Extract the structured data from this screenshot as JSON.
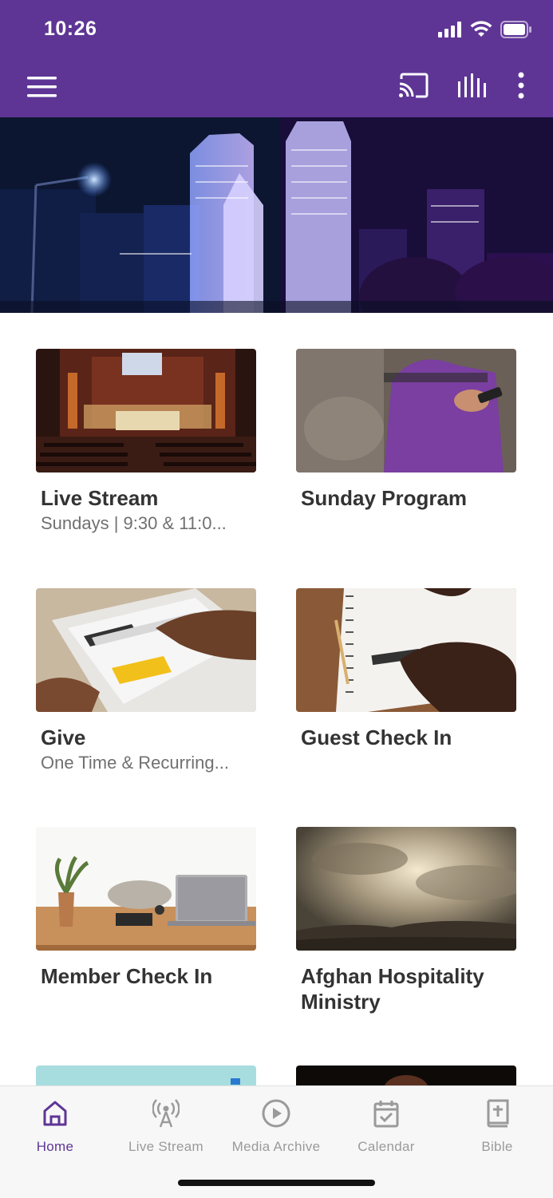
{
  "status_bar": {
    "time": "10:26"
  },
  "app_bar": {
    "menu_icon": "hamburger-menu-icon",
    "cast_icon": "cast-icon",
    "audio_icon": "audio-bars-icon",
    "more_icon": "more-vertical-icon"
  },
  "tiles": [
    {
      "title": "Live Stream",
      "subtitle": "Sundays | 9:30 & 11:0..."
    },
    {
      "title": "Sunday Program",
      "subtitle": ""
    },
    {
      "title": "Give",
      "subtitle": "One Time & Recurring..."
    },
    {
      "title": "Guest Check In",
      "subtitle": ""
    },
    {
      "title": "Member Check In",
      "subtitle": ""
    },
    {
      "title": "Afghan Hospitality Ministry",
      "subtitle": ""
    }
  ],
  "tabs": [
    {
      "label": "Home",
      "icon": "home-icon"
    },
    {
      "label": "Live Stream",
      "icon": "broadcast-icon"
    },
    {
      "label": "Media Archive",
      "icon": "play-circle-icon"
    },
    {
      "label": "Calendar",
      "icon": "calendar-icon"
    },
    {
      "label": "Bible",
      "icon": "bible-icon"
    }
  ],
  "colors": {
    "brand": "#5e3595",
    "tab_inactive": "#9a9a9a"
  }
}
